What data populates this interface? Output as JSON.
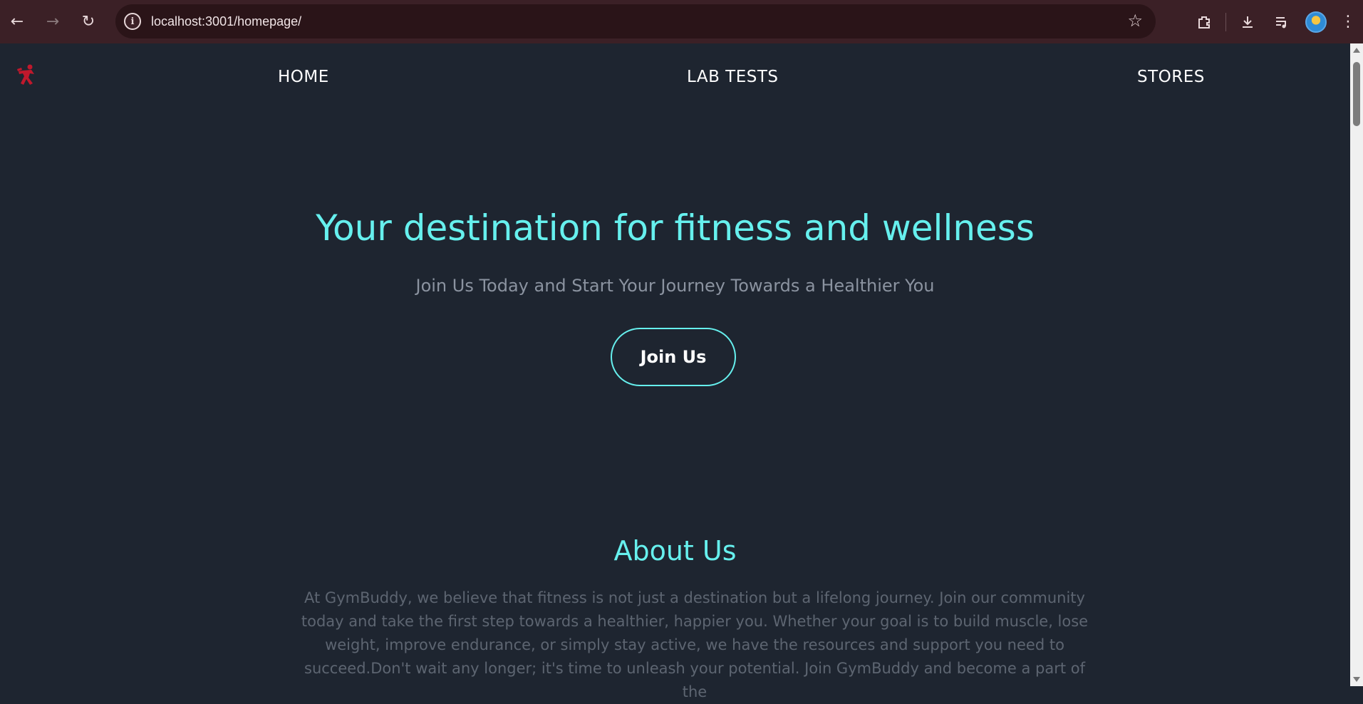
{
  "browser": {
    "url": "localhost:3001/homepage/",
    "icons": [
      "back-arrow-icon",
      "forward-arrow-icon",
      "reload-icon",
      "site-info-icon",
      "bookmark-star-icon",
      "extensions-icon",
      "download-icon",
      "media-queue-icon",
      "profile-avatar-icon",
      "menu-kebab-icon"
    ]
  },
  "nav": {
    "items": [
      {
        "label": "HOME"
      },
      {
        "label": "LAB TESTS"
      },
      {
        "label": "STORES"
      }
    ]
  },
  "hero": {
    "title": "Your destination for fitness and wellness",
    "subtitle": "Join Us Today and Start Your Journey Towards a Healthier You",
    "cta_label": "Join Us"
  },
  "about": {
    "title": "About Us",
    "text": "At GymBuddy, we believe that fitness is not just a destination but a lifelong journey. Join our community today and take the first step towards a healthier, happier you. Whether your goal is to build muscle, lose weight, improve endurance, or simply stay active, we have the resources and support you need to succeed.Don't wait any longer; it's time to unleash your potential. Join GymBuddy and become a part of the"
  },
  "colors": {
    "accent": "#66f0ee",
    "background": "#1e2530",
    "chrome": "#3b2026",
    "logo": "#c0182c"
  }
}
